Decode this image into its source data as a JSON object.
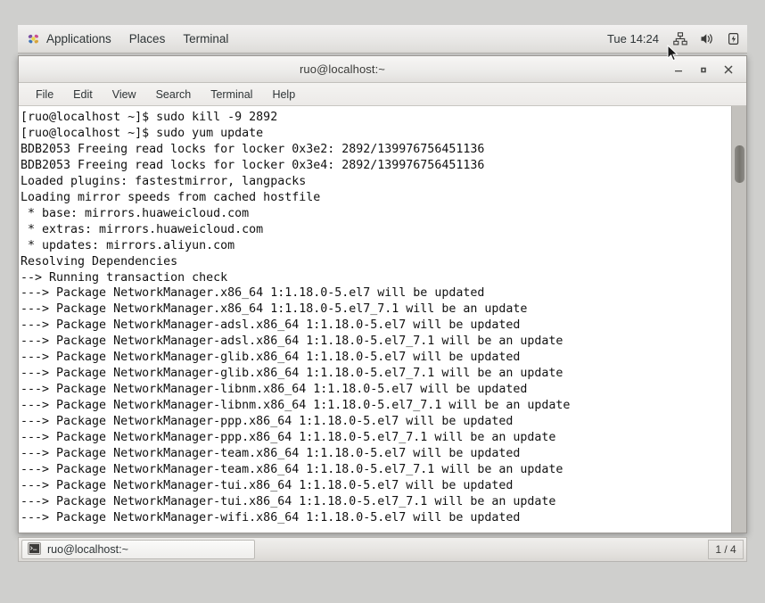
{
  "top_panel": {
    "applications_label": "Applications",
    "places_label": "Places",
    "terminal_label": "Terminal",
    "clock": "Tue 14:24",
    "tray": [
      {
        "name": "network-icon",
        "label": "network"
      },
      {
        "name": "volume-icon",
        "label": "volume"
      },
      {
        "name": "battery-icon",
        "label": "battery"
      }
    ]
  },
  "window": {
    "title": "ruo@localhost:~",
    "minimize_label": "–",
    "maximize_label": "□",
    "close_label": "✕",
    "menus": [
      "File",
      "Edit",
      "View",
      "Search",
      "Terminal",
      "Help"
    ]
  },
  "terminal": {
    "lines": [
      "[ruo@localhost ~]$ sudo kill -9 2892",
      "[ruo@localhost ~]$ sudo yum update",
      "BDB2053 Freeing read locks for locker 0x3e2: 2892/139976756451136",
      "BDB2053 Freeing read locks for locker 0x3e4: 2892/139976756451136",
      "Loaded plugins: fastestmirror, langpacks",
      "Loading mirror speeds from cached hostfile",
      " * base: mirrors.huaweicloud.com",
      " * extras: mirrors.huaweicloud.com",
      " * updates: mirrors.aliyun.com",
      "Resolving Dependencies",
      "--> Running transaction check",
      "---> Package NetworkManager.x86_64 1:1.18.0-5.el7 will be updated",
      "---> Package NetworkManager.x86_64 1:1.18.0-5.el7_7.1 will be an update",
      "---> Package NetworkManager-adsl.x86_64 1:1.18.0-5.el7 will be updated",
      "---> Package NetworkManager-adsl.x86_64 1:1.18.0-5.el7_7.1 will be an update",
      "---> Package NetworkManager-glib.x86_64 1:1.18.0-5.el7 will be updated",
      "---> Package NetworkManager-glib.x86_64 1:1.18.0-5.el7_7.1 will be an update",
      "---> Package NetworkManager-libnm.x86_64 1:1.18.0-5.el7 will be updated",
      "---> Package NetworkManager-libnm.x86_64 1:1.18.0-5.el7_7.1 will be an update",
      "---> Package NetworkManager-ppp.x86_64 1:1.18.0-5.el7 will be updated",
      "---> Package NetworkManager-ppp.x86_64 1:1.18.0-5.el7_7.1 will be an update",
      "---> Package NetworkManager-team.x86_64 1:1.18.0-5.el7 will be updated",
      "---> Package NetworkManager-team.x86_64 1:1.18.0-5.el7_7.1 will be an update",
      "---> Package NetworkManager-tui.x86_64 1:1.18.0-5.el7 will be updated",
      "---> Package NetworkManager-tui.x86_64 1:1.18.0-5.el7_7.1 will be an update",
      "---> Package NetworkManager-wifi.x86_64 1:1.18.0-5.el7 will be updated"
    ]
  },
  "taskbar": {
    "window_button_label": "ruo@localhost:~",
    "workspace_indicator": "1 / 4"
  },
  "colors": {
    "desktop_background": "#cfcfcd",
    "panel_background": "#e8e7e5",
    "terminal_background": "#ffffff",
    "terminal_text": "#111111",
    "scrollbar_trough": "#c3c1bd",
    "scrollbar_thumb": "#77756f"
  }
}
